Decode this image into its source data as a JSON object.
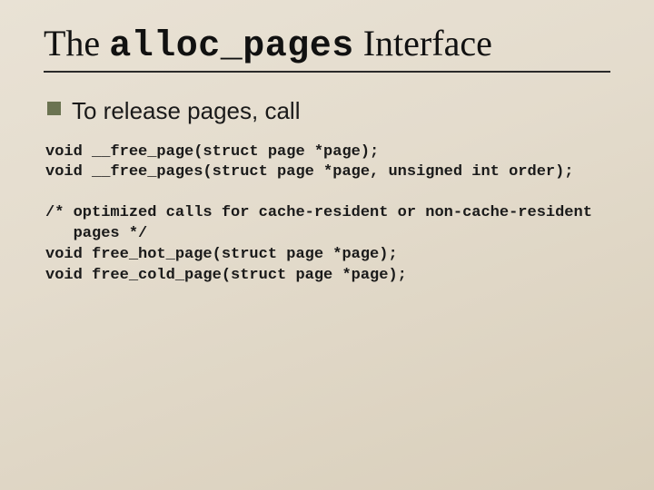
{
  "title": {
    "pre": "The ",
    "mono": "alloc_pages",
    "post": " Interface"
  },
  "bullet": "To release pages, call",
  "code1": "void __free_page(struct page *page);\nvoid __free_pages(struct page *page, unsigned int order);",
  "code2": "/* optimized calls for cache-resident or non-cache-resident\n   pages */\nvoid free_hot_page(struct page *page);\nvoid free_cold_page(struct page *page);"
}
